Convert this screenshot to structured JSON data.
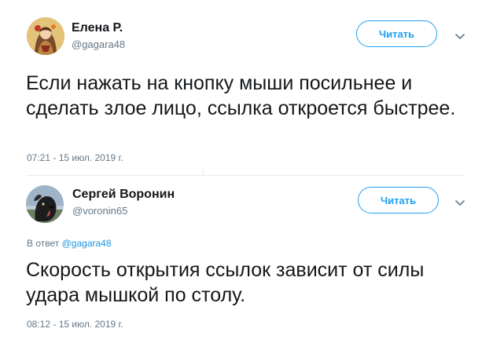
{
  "tweets": [
    {
      "author_name": "Елена Р.",
      "handle": "@gagara48",
      "follow_label": "Читать",
      "text": "Если нажать на кнопку мыши посильнее и сделать злое лицо, ссылка откроется быстрее.",
      "timestamp": "07:21 - 15 июл. 2019 г.",
      "avatar_icon": "illustrated-woman-avatar"
    },
    {
      "author_name": "Сергей Воронин",
      "handle": "@voronin65",
      "follow_label": "Читать",
      "reply_prefix": "В ответ",
      "reply_to": "@gagara48",
      "text": "Скорость открытия ссылок зависит от силы удара мышкой по столу.",
      "timestamp": "08:12 - 15 июл. 2019 г.",
      "avatar_icon": "black-dog-avatar"
    }
  ],
  "colors": {
    "accent": "#1da1f2",
    "link": "#1b95e0",
    "secondary_text": "#657786",
    "primary_text": "#14171a",
    "divider": "#e6ecf0"
  }
}
